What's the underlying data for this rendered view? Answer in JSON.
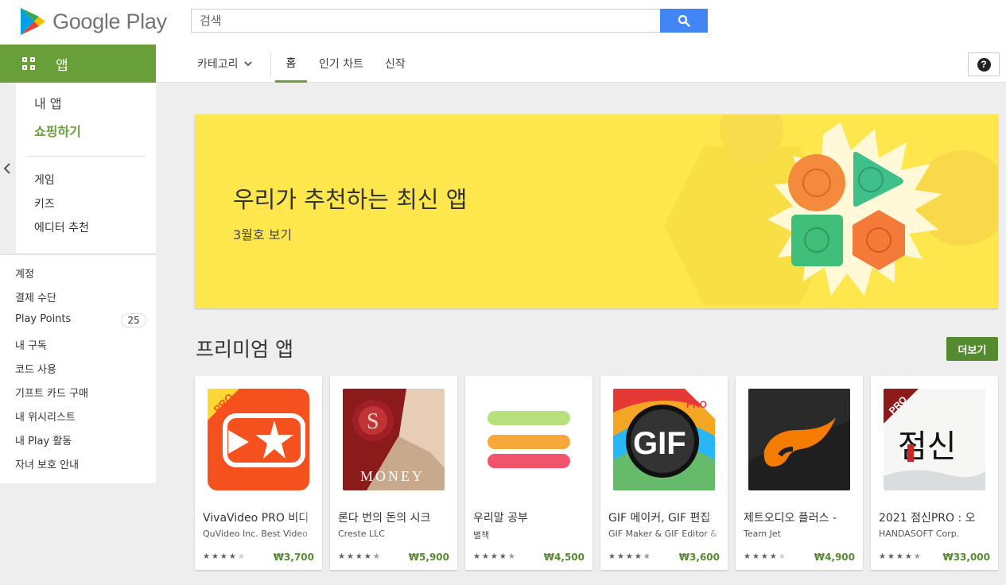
{
  "header": {
    "logo_text": "Google Play",
    "search_placeholder": "검색"
  },
  "nav": {
    "apps_label": "앱",
    "category": "카테고리",
    "tabs": [
      "홈",
      "인기 차트",
      "신작"
    ]
  },
  "sidebar": {
    "primary": [
      "내 앱",
      "쇼핑하기"
    ],
    "secondary": [
      "게임",
      "키즈",
      "에디터 추천"
    ],
    "account": [
      "계정",
      "결제 수단",
      "Play Points",
      "내 구독",
      "코드 사용",
      "기프트 카드 구매",
      "내 위시리스트",
      "내 Play 활동",
      "자녀 보호 안내"
    ],
    "points_badge": "25"
  },
  "banner": {
    "title": "우리가 추천하는 최신 앱",
    "subtitle": "3월호 보기"
  },
  "section": {
    "title": "프리미엄 앱",
    "more_label": "더보기"
  },
  "apps": [
    {
      "title": "VivaVideo PRO 비디",
      "dev": "QuVideo Inc. Best Video",
      "price": "₩3,700",
      "rating": 4
    },
    {
      "title": "론다 번의 돈의 시크",
      "dev": "Creste LLC",
      "price": "₩5,900",
      "rating": 4.5
    },
    {
      "title": "우리말 공부",
      "dev": "별책",
      "price": "₩4,500",
      "rating": 4.5
    },
    {
      "title": "GIF 메이커, GIF 편집",
      "dev": "GIF Maker & GIF Editor &",
      "price": "₩3,600",
      "rating": 4.5
    },
    {
      "title": "제트오디오 플러스 -",
      "dev": "Team Jet",
      "price": "₩4,900",
      "rating": 4
    },
    {
      "title": "2021 점신PRO : 오",
      "dev": "HANDASOFT Corp.",
      "price": "₩33,000",
      "rating": 4.5
    }
  ],
  "icon_texts": {
    "pro": "PRO",
    "money": "MONEY",
    "gif": "GIF",
    "jeomsin": "점신"
  },
  "colors": {
    "brand_green": "#689f38",
    "search_blue": "#4285f4",
    "banner_yellow": "#fde74c",
    "price_green": "#558b2f"
  }
}
